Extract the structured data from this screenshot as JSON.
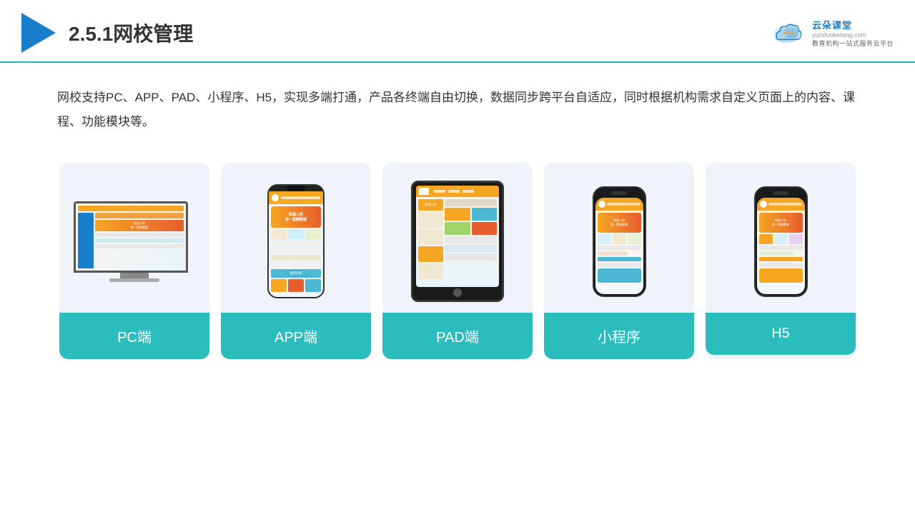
{
  "header": {
    "title": "2.5.1网校管理",
    "logo_brand": "云朵课堂",
    "logo_url": "yunduoketang.com",
    "logo_tagline": "教育机构一站式服务云平台"
  },
  "description": {
    "text": "网校支持PC、APP、PAD、小程序、H5，实现多端打通，产品各终端自由切换，数据同步跨平台自适应，同时根据机构需求自定义页面上的内容、课程、功能模块等。"
  },
  "cards": [
    {
      "id": "pc",
      "label": "PC端"
    },
    {
      "id": "app",
      "label": "APP端"
    },
    {
      "id": "pad",
      "label": "PAD端"
    },
    {
      "id": "miniprogram",
      "label": "小程序"
    },
    {
      "id": "h5",
      "label": "H5"
    }
  ],
  "colors": {
    "accent": "#2bbdbd",
    "header_line": "#1ab3c8",
    "logo_blue": "#1a7fcb",
    "triangle": "#1a7fcb"
  }
}
